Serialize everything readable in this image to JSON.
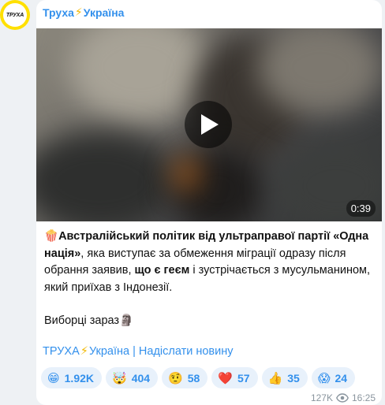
{
  "channel": {
    "name_part1": "Труха",
    "bolt": "⚡",
    "name_part2": "Україна",
    "avatar_text": "ТРУХА"
  },
  "video": {
    "duration": "0:39"
  },
  "post": {
    "popcorn": "🍿",
    "bold1": "Австралійський політик від ультраправої партії «Одна нація»",
    "text1": ", яка виступає за обмеження міграції одразу після обрання заявив, ",
    "bold2": "що є геєм",
    "text2": " і зустрічається з мусульманином, який приїхав з Індонезії.",
    "footer": "Виборці зараз",
    "footer_emoji": "🗿",
    "link_part1": "ТРУХА",
    "link_bolt": "⚡",
    "link_part2": "Україна | Надіслати новину"
  },
  "reactions": [
    {
      "emoji": "😁",
      "count": "1.92K"
    },
    {
      "emoji": "🤯",
      "count": "404"
    },
    {
      "emoji": "🤨",
      "count": "58"
    },
    {
      "emoji": "❤️",
      "count": "57"
    },
    {
      "emoji": "👍",
      "count": "35"
    },
    {
      "emoji": "😱",
      "count": "24"
    }
  ],
  "meta": {
    "views": "127K",
    "time": "16:25"
  }
}
